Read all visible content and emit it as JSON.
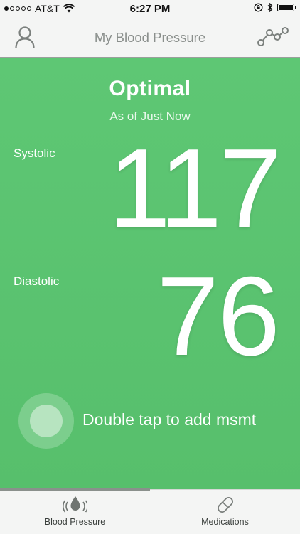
{
  "status_bar": {
    "carrier": "AT&T",
    "time": "6:27 PM",
    "signal_dots_filled": 1,
    "signal_dots_total": 5
  },
  "nav": {
    "title": "My Blood Pressure",
    "left_icon": "person-icon",
    "right_icon": "trends-graph-icon"
  },
  "reading": {
    "category": "Optimal",
    "as_of": "As of Just Now",
    "systolic_label": "Systolic",
    "systolic_value": "117",
    "diastolic_label": "Diastolic",
    "diastolic_value": "76"
  },
  "add_measurement": {
    "hint": "Double tap to add msmt"
  },
  "tabs": [
    {
      "label": "Blood Pressure",
      "icon": "blood-drop-icon",
      "selected": true
    },
    {
      "label": "Medications",
      "icon": "pill-icon",
      "selected": false
    }
  ],
  "colors": {
    "accent_green": "#5ec774",
    "nav_text": "#8a8f8c",
    "background": "#f4f5f4"
  }
}
